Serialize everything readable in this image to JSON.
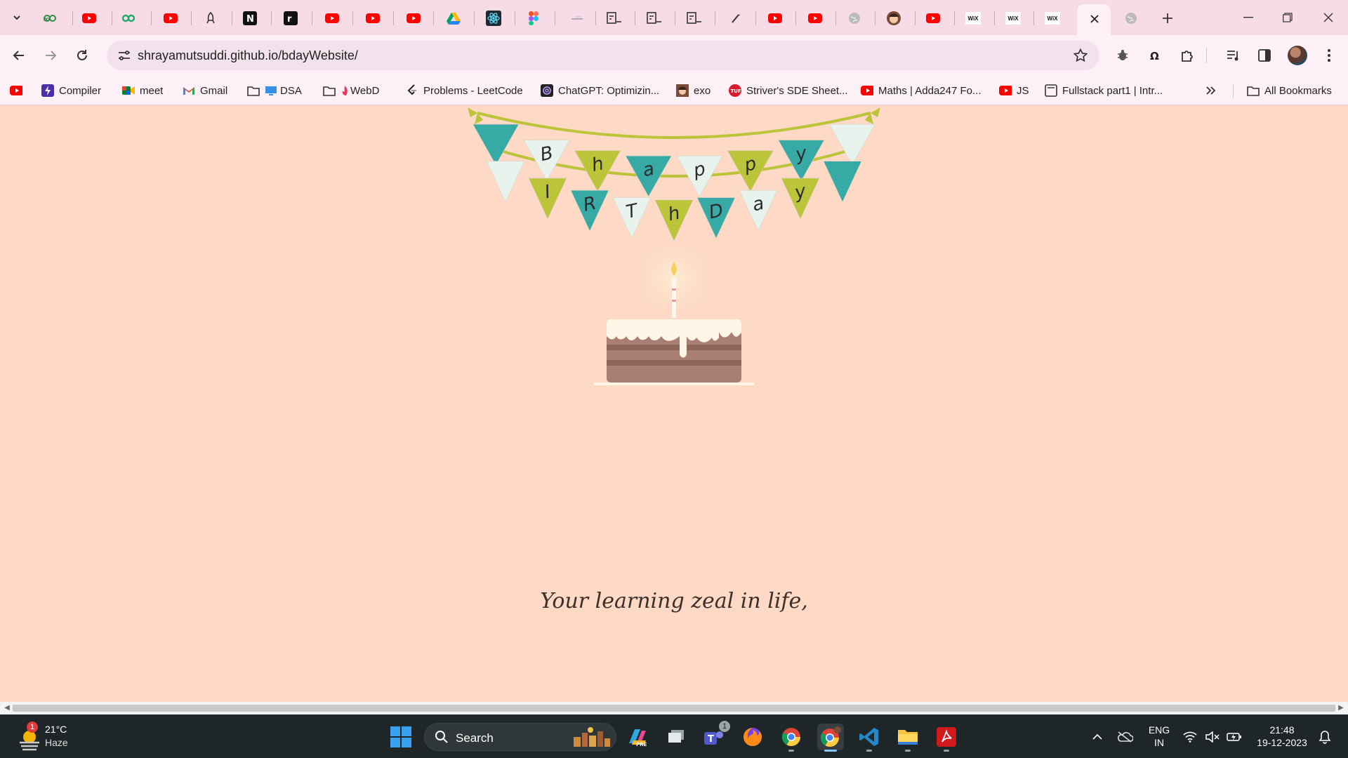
{
  "browser": {
    "tabs": [
      {
        "icon": "geeksforgeeks-icon"
      },
      {
        "icon": "youtube-icon"
      },
      {
        "icon": "leetcode-infinity-icon"
      },
      {
        "icon": "youtube-icon"
      },
      {
        "icon": "rocket-icon"
      },
      {
        "icon": "notion-icon"
      },
      {
        "icon": "notion-icon"
      },
      {
        "icon": "youtube-icon"
      },
      {
        "icon": "youtube-icon"
      },
      {
        "icon": "youtube-icon"
      },
      {
        "icon": "google-drive-icon"
      },
      {
        "icon": "react-icon"
      },
      {
        "icon": "figma-icon"
      },
      {
        "icon": "blank-page-icon"
      },
      {
        "icon": "codepen-icon"
      },
      {
        "icon": "codepen-icon"
      },
      {
        "icon": "codepen-icon"
      },
      {
        "icon": "wand-icon"
      },
      {
        "icon": "youtube-icon"
      },
      {
        "icon": "youtube-icon"
      },
      {
        "icon": "globe-icon"
      },
      {
        "icon": "avatar-icon"
      },
      {
        "icon": "youtube-icon"
      },
      {
        "icon": "wix-icon",
        "text": "WiX"
      },
      {
        "icon": "wix-icon",
        "text": "WiX"
      },
      {
        "icon": "wix-icon",
        "text": "WiX"
      },
      {
        "icon": "close-icon",
        "active": true
      },
      {
        "icon": "globe-icon"
      }
    ],
    "url": "shrayamutsuddi.github.io/bdayWebsite/",
    "colors": {
      "tabstrip": "#f7dbe7",
      "toolbar": "#fdf1f7",
      "page_bg": "#fdd9c6"
    }
  },
  "bookmarks": [
    {
      "label": "",
      "icon": "youtube-icon"
    },
    {
      "label": "Compiler",
      "icon": "compiler-icon"
    },
    {
      "label": "meet",
      "icon": "google-meet-icon"
    },
    {
      "label": "Gmail",
      "icon": "gmail-icon"
    },
    {
      "label": "DSA",
      "icon": "folder-icon"
    },
    {
      "label": "WebD",
      "icon": "folder-icon"
    },
    {
      "label": "Problems - LeetCode",
      "icon": "leetcode-icon"
    },
    {
      "label": "ChatGPT: Optimizin...",
      "icon": "chatgpt-icon"
    },
    {
      "label": "exo",
      "icon": "avatar-icon"
    },
    {
      "label": "Striver's SDE Sheet...",
      "icon": "tuf-icon"
    },
    {
      "label": "Maths | Adda247 Fo...",
      "icon": "youtube-icon"
    },
    {
      "label": "JS",
      "icon": "youtube-icon"
    },
    {
      "label": "Fullstack part1 | Intr...",
      "icon": "page-icon"
    }
  ],
  "all_bookmarks_label": "All Bookmarks",
  "page": {
    "banner_row1": [
      "B",
      "h",
      "a",
      "p",
      "p",
      "y"
    ],
    "banner_row2": [
      "I",
      "R",
      "T",
      "h",
      "D",
      "a",
      "y"
    ],
    "message": "Your learning zeal in life,"
  },
  "taskbar": {
    "weather_temp": "21°C",
    "weather_cond": "Haze",
    "weather_badge": "1",
    "search_label": "Search",
    "teams_badge": "1",
    "lang_line1": "ENG",
    "lang_line2": "IN",
    "time": "21:48",
    "date": "19-12-2023"
  }
}
